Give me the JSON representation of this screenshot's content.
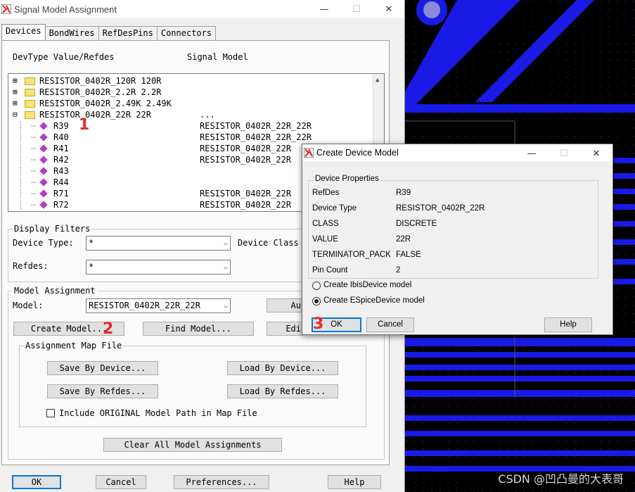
{
  "main_window": {
    "title": "Signal Model Assignment",
    "controls": {
      "minimize": "—",
      "maximize": "☐",
      "close": "✕"
    }
  },
  "tabs": [
    "Devices",
    "BondWires",
    "RefDesPins",
    "Connectors"
  ],
  "devices": {
    "header_left": "DevType Value/Refdes",
    "header_right": "Signal Model",
    "tree": [
      {
        "type": "folder",
        "expander": "⊞",
        "label": "RESISTOR_0402R_120R 120R",
        "model": ""
      },
      {
        "type": "folder",
        "expander": "⊞",
        "label": "RESISTOR_0402R_2.2R 2.2R",
        "model": ""
      },
      {
        "type": "folder",
        "expander": "⊞",
        "label": "RESISTOR_0402R_2.49K 2.49K",
        "model": ""
      },
      {
        "type": "folder-open",
        "expander": "⊟",
        "label": "RESISTOR_0402R_22R 22R",
        "model": "..."
      },
      {
        "type": "item",
        "label": "R39",
        "model": "RESISTOR_0402R_22R_22R"
      },
      {
        "type": "item",
        "label": "R40",
        "model": "RESISTOR_0402R_22R_22R"
      },
      {
        "type": "item",
        "label": "R41",
        "model": "RESISTOR_0402R_22R"
      },
      {
        "type": "item",
        "label": "R42",
        "model": "RESISTOR_0402R_22R"
      },
      {
        "type": "item",
        "label": "R43",
        "model": ""
      },
      {
        "type": "item",
        "label": "R44",
        "model": ""
      },
      {
        "type": "item",
        "label": "R71",
        "model": "RESISTOR_0402R_22R"
      },
      {
        "type": "item",
        "label": "R72",
        "model": "RESISTOR_0402R_22R"
      }
    ],
    "display_filters": {
      "title": "Display Filters",
      "device_type_label": "Device Type:",
      "device_type_value": "*",
      "device_class_label": "Device Class",
      "refdes_label": "Refdes:",
      "refdes_value": "*"
    },
    "model_assignment": {
      "title": "Model Assignment",
      "model_label": "Model:",
      "model_value": "RESISTOR_0402R_22R_22R",
      "auto_label": "Au",
      "create_model": "Create Model...",
      "find_model": "Find Model...",
      "edit_label": "Edi"
    },
    "map_file": {
      "title": "Assignment Map File",
      "save_by_device": "Save By Device...",
      "load_by_device": "Load By Device...",
      "save_by_refdes": "Save By Refdes...",
      "load_by_refdes": "Load By Refdes...",
      "include_path": "Include ORIGINAL Model Path in Map File",
      "include_path_checked": false
    },
    "clear_all": "Clear All Model Assignments"
  },
  "footer_buttons": {
    "ok": "OK",
    "cancel": "Cancel",
    "preferences": "Preferences...",
    "help": "Help"
  },
  "annotations": {
    "step1": "1",
    "step2": "2",
    "step3": "3"
  },
  "dialog": {
    "title": "Create Device Model",
    "controls": {
      "minimize": "—",
      "maximize": "☐",
      "close": "✕"
    },
    "group_title": "Device Properties",
    "properties": [
      {
        "name": "RefDes",
        "value": "R39"
      },
      {
        "name": "Device Type",
        "value": "RESISTOR_0402R_22R"
      },
      {
        "name": "CLASS",
        "value": "DISCRETE"
      },
      {
        "name": "VALUE",
        "value": "22R"
      },
      {
        "name": "TERMINATOR_PACK",
        "value": "FALSE"
      },
      {
        "name": "Pin Count",
        "value": "2"
      }
    ],
    "radio_ibis": "Create IbisDevice model",
    "radio_espice": "Create ESpiceDevice model",
    "selected": "espice",
    "ok": "OK",
    "cancel": "Cancel",
    "help": "Help"
  },
  "watermark": "CSDN @凹凸曼的大表哥",
  "colors": {
    "pcb_trace": "#1a1ae6",
    "pcb_background": "#000000",
    "accent": "#0078d7",
    "annotation": "#e32b2b"
  }
}
